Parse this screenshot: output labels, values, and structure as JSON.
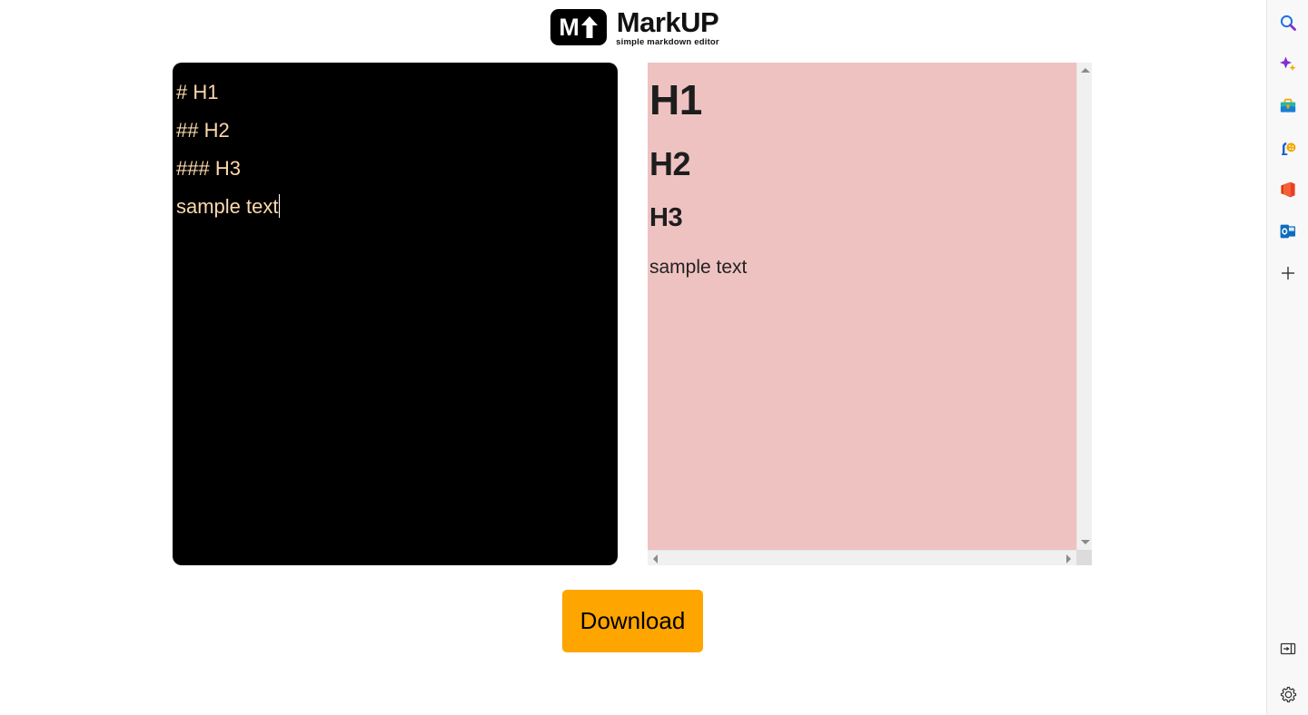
{
  "app": {
    "logo_letter": "M",
    "logo_arrow_icon": "up-arrow-icon",
    "title": "MarkUP",
    "tagline": "simple markdown editor"
  },
  "editor": {
    "name": "markdown-source-editor",
    "value": "# H1\n## H2\n### H3\nsample text",
    "text_color": "#fbd9ab",
    "background_color": "#000000",
    "caret_visible": true
  },
  "preview": {
    "name": "markdown-preview",
    "background_color": "#efc2c2",
    "blocks": [
      {
        "tag": "h1",
        "text": "H1"
      },
      {
        "tag": "h2",
        "text": "H2"
      },
      {
        "tag": "h3",
        "text": "H3"
      },
      {
        "tag": "p",
        "text": "sample text"
      }
    ],
    "h1": "H1",
    "h2": "H2",
    "h3": "H3",
    "paragraph": "sample text",
    "scrollbar": {
      "vertical_up_icon": "scroll-up-arrow-icon",
      "vertical_down_icon": "scroll-down-arrow-icon",
      "horizontal_left_icon": "scroll-left-arrow-icon",
      "horizontal_right_icon": "scroll-right-arrow-icon"
    }
  },
  "actions": {
    "download_label": "Download",
    "download_color": "#ffa500"
  },
  "browser_sidebar": {
    "top_items": [
      {
        "icon": "search-icon",
        "label": "Search"
      },
      {
        "icon": "copilot-sparkle-icon",
        "label": "Copilot"
      },
      {
        "icon": "shopping-briefcase-icon",
        "label": "Shopping"
      },
      {
        "icon": "games-icon",
        "label": "Games"
      },
      {
        "icon": "office-icon",
        "label": "Office"
      },
      {
        "icon": "outlook-icon",
        "label": "Outlook"
      },
      {
        "icon": "plus-icon",
        "label": "Customize"
      }
    ],
    "bottom_items": [
      {
        "icon": "toggle-sidebar-icon",
        "label": "Toggle sidebar"
      },
      {
        "icon": "gear-icon",
        "label": "Settings"
      }
    ]
  }
}
